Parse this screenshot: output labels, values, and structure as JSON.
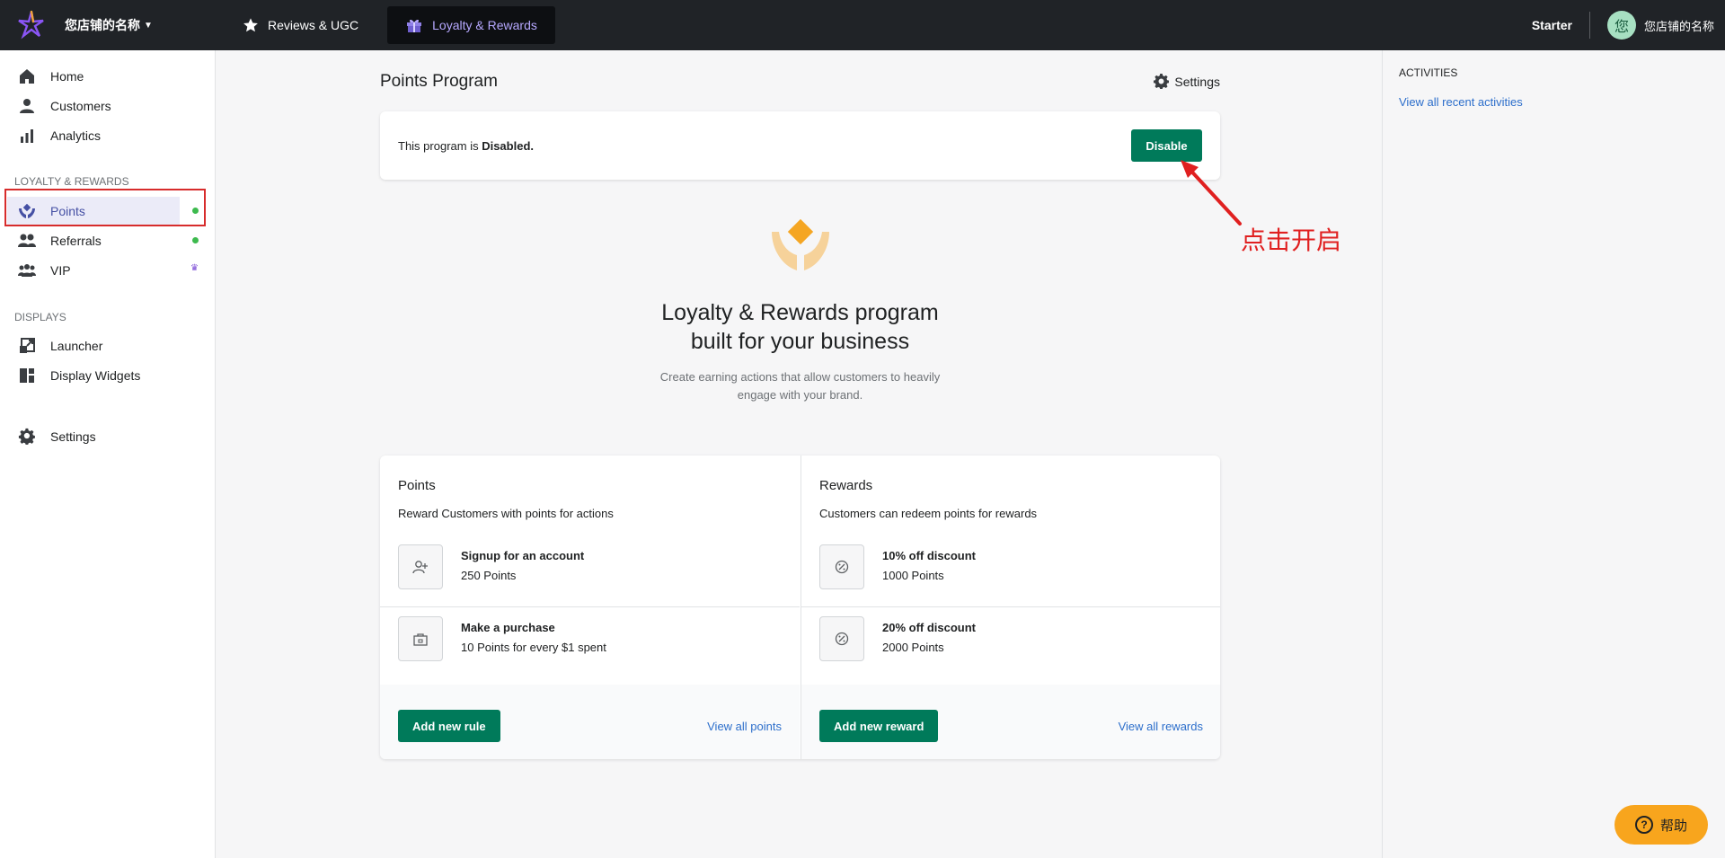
{
  "topbar": {
    "store_name": "您店铺的名称",
    "tabs": [
      {
        "label": "Reviews & UGC",
        "icon": "star-icon"
      },
      {
        "label": "Loyalty & Rewards",
        "icon": "gift-icon",
        "active": true
      }
    ],
    "plan": "Starter",
    "avatar_initial": "您",
    "account_name": "您店铺的名称"
  },
  "sidebar": {
    "main_items": [
      {
        "label": "Home",
        "icon": "home-icon"
      },
      {
        "label": "Customers",
        "icon": "person-icon"
      },
      {
        "label": "Analytics",
        "icon": "bar-chart-icon"
      }
    ],
    "loyalty_heading": "LOYALTY & REWARDS",
    "loyalty_items": [
      {
        "label": "Points",
        "icon": "hands-icon",
        "selected": true,
        "status": "green-dot"
      },
      {
        "label": "Referrals",
        "icon": "people-icon",
        "status": "green-dot"
      },
      {
        "label": "VIP",
        "icon": "group-icon",
        "status": "crown"
      }
    ],
    "displays_heading": "DISPLAYS",
    "display_items": [
      {
        "label": "Launcher",
        "icon": "launcher-icon"
      },
      {
        "label": "Display Widgets",
        "icon": "widgets-icon"
      }
    ],
    "settings_label": "Settings"
  },
  "main": {
    "page_title": "Points Program",
    "settings_label": "Settings",
    "status": {
      "prefix": "This program is ",
      "value": "Disabled.",
      "button_label": "Disable"
    },
    "hero": {
      "title_line1": "Loyalty & Rewards program",
      "title_line2": "built for your business",
      "sub_line1": "Create earning actions that allow customers to heavily",
      "sub_line2": "engage with your brand."
    },
    "points_panel": {
      "title": "Points",
      "description": "Reward Customers with points for actions",
      "rules": [
        {
          "title": "Signup for an account",
          "value": "250 Points",
          "icon": "add-person-icon"
        },
        {
          "title": "Make a purchase",
          "value": "10 Points for every $1 spent",
          "icon": "shopping-bag-icon"
        }
      ],
      "button_label": "Add new rule",
      "link_label": "View all points"
    },
    "rewards_panel": {
      "title": "Rewards",
      "description": "Customers can redeem points for rewards",
      "rewards": [
        {
          "title": "10% off discount",
          "value": "1000 Points",
          "icon": "discount-icon"
        },
        {
          "title": "20% off discount",
          "value": "2000 Points",
          "icon": "discount-icon"
        }
      ],
      "button_label": "Add new reward",
      "link_label": "View all rewards"
    }
  },
  "annotation": {
    "text": "点击开启",
    "color": "#e02020"
  },
  "activities": {
    "title": "ACTIVITIES",
    "link": "View all recent activities"
  },
  "help": {
    "label": "帮助"
  },
  "colors": {
    "primary_green": "#007a5a",
    "topbar": "#202327",
    "accent_purple": "#4550a4",
    "link_blue": "#2c6ecb",
    "help_orange": "#f8a51d"
  }
}
